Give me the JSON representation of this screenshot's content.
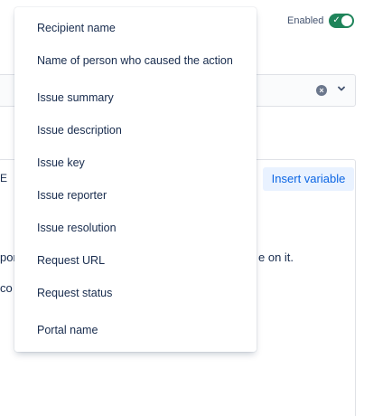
{
  "header": {
    "enabled_label": "Enabled",
    "toggle_on": true
  },
  "editor": {
    "toolbar_fragment": "E",
    "insert_variable_label": "Insert variable",
    "fragments": [
      "por",
      "co t",
      "e on it."
    ]
  },
  "menu": {
    "items": [
      "Recipient name",
      "Name of person who caused the action",
      "Issue summary",
      "Issue description",
      "Issue key",
      "Issue reporter",
      "Issue resolution",
      "Request URL",
      "Request status",
      "Portal name"
    ]
  },
  "colors": {
    "toggle": "#1f845a",
    "insert_variable_bg": "#e9f2ff",
    "insert_variable_text": "#0c66e4"
  }
}
